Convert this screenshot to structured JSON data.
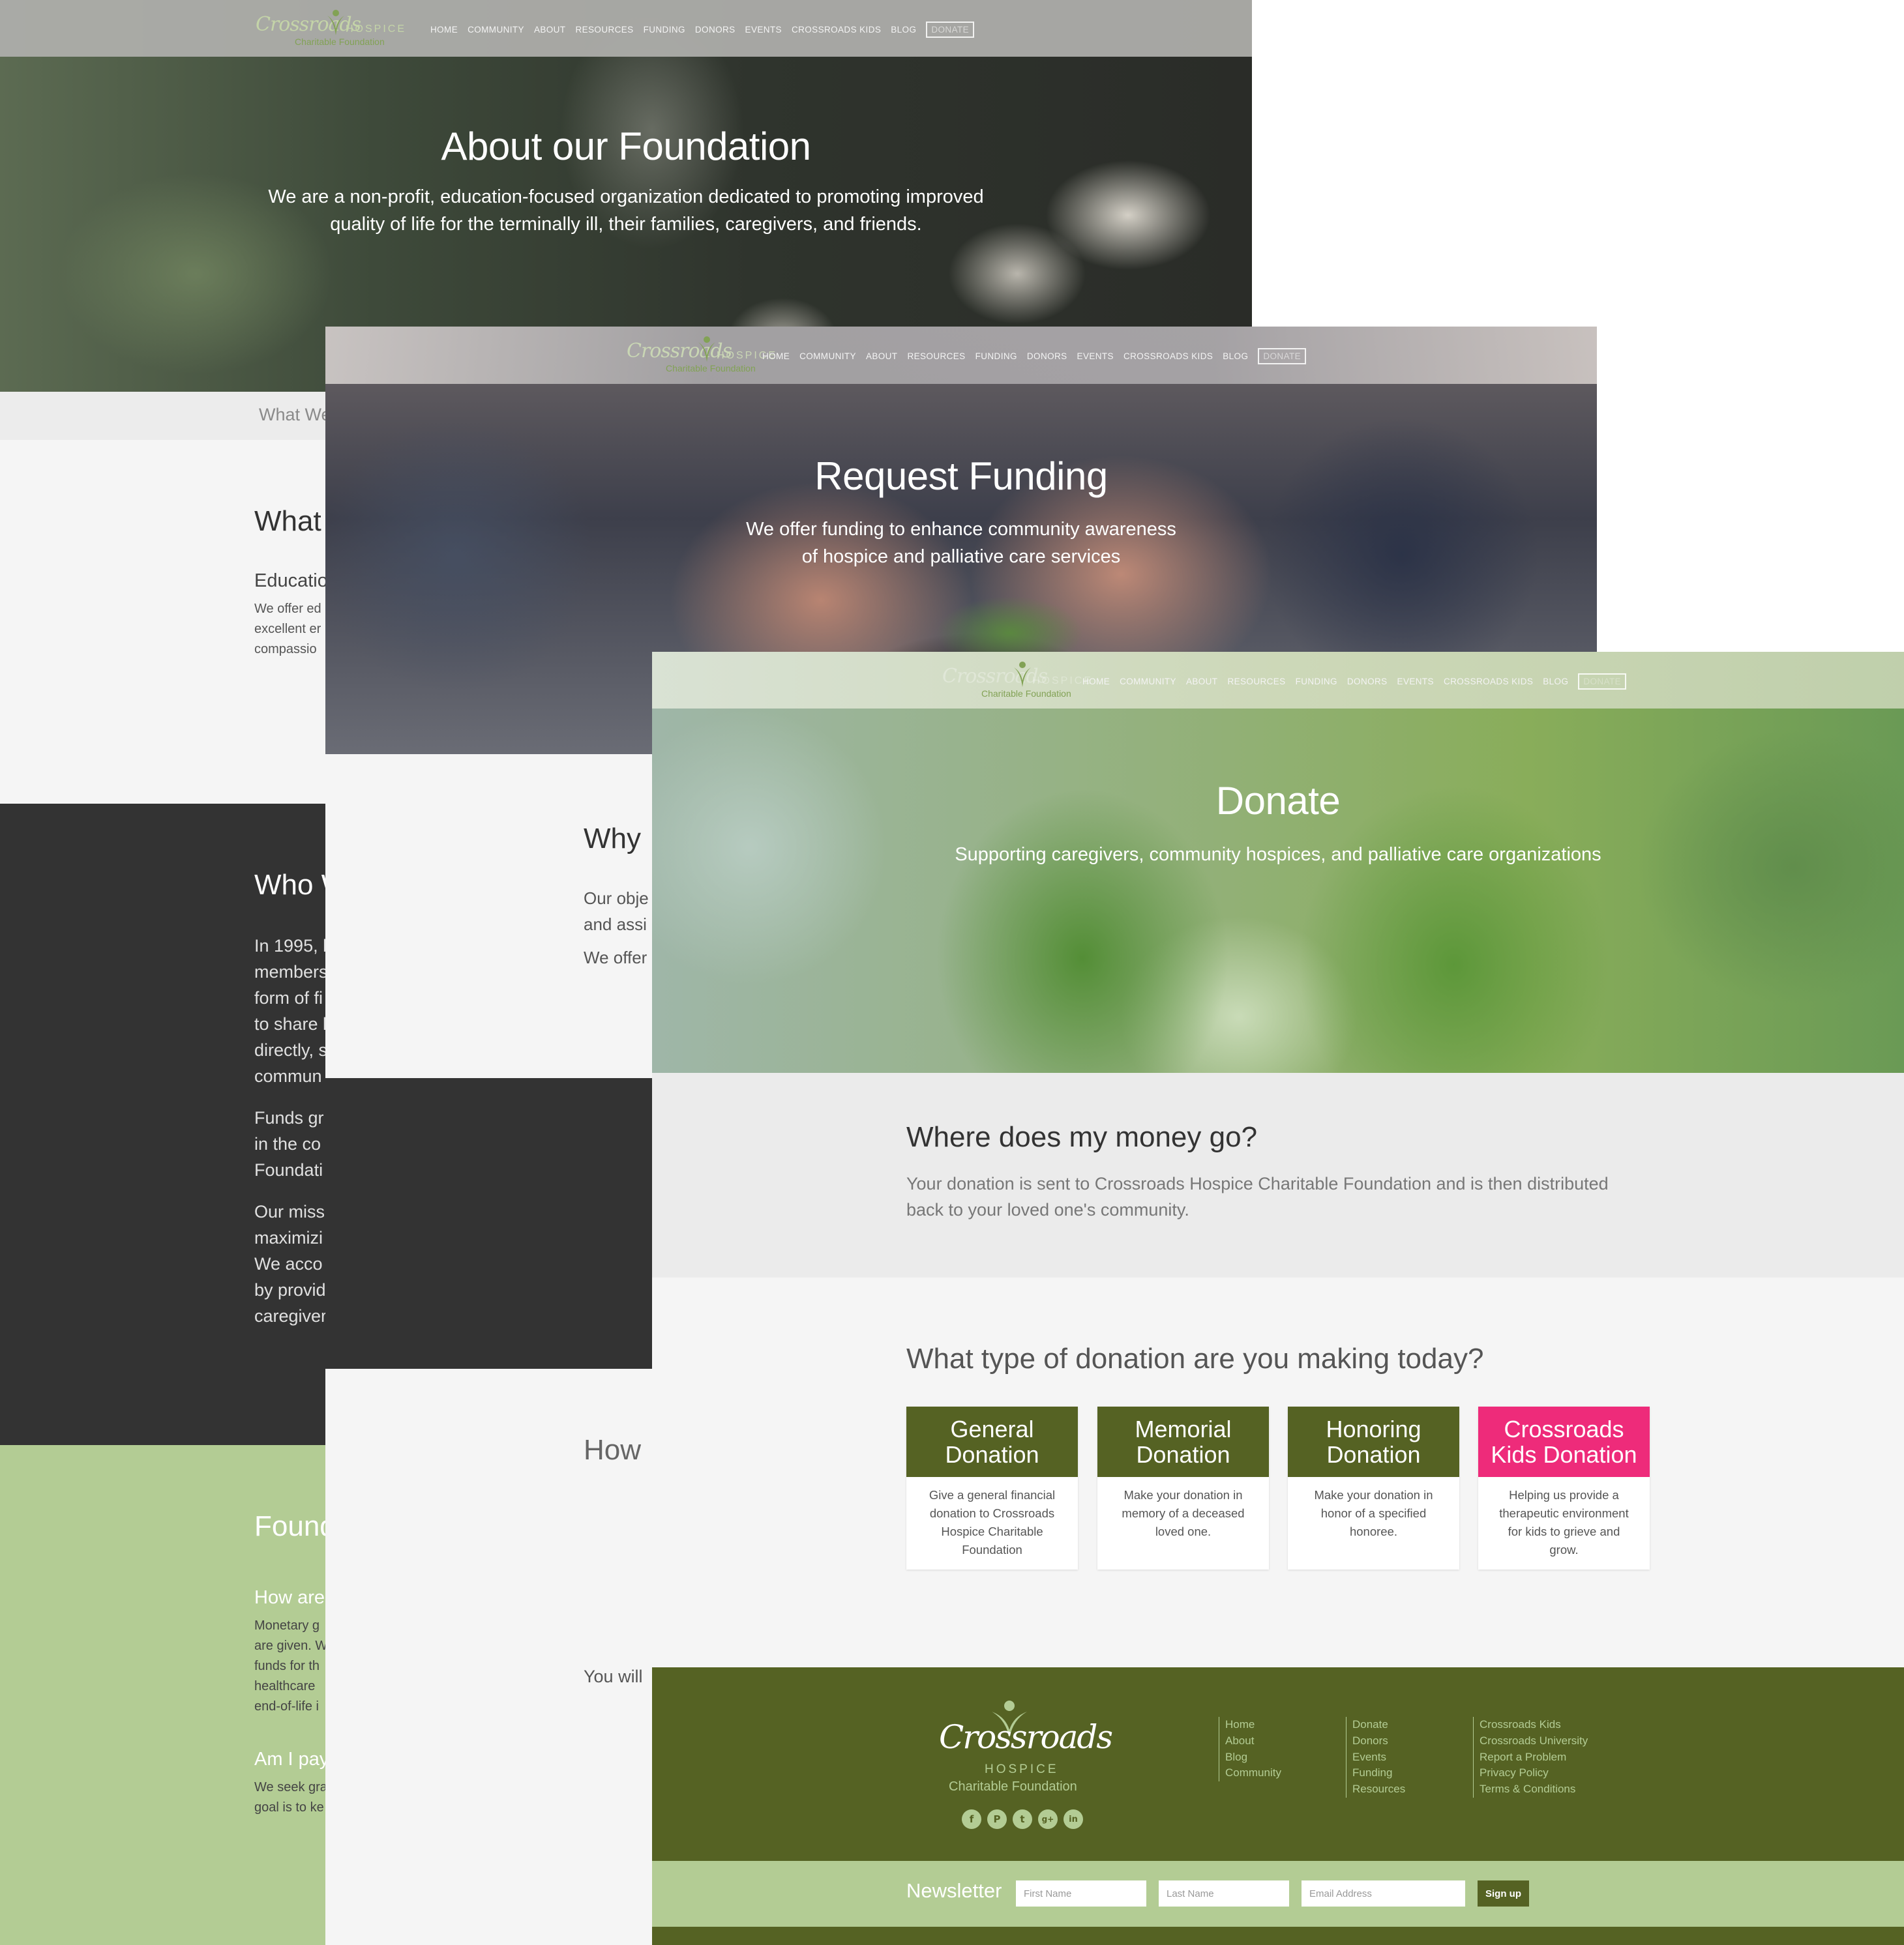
{
  "colors": {
    "olive": "#556223",
    "sage": "#b3cc94",
    "dark": "#333333",
    "pink": "#ee2b7a",
    "light": "#f5f5f5",
    "gray_band": "#ebebeb"
  },
  "nav": {
    "logo_script": "Crossroads",
    "logo_hospice": "HOSPICE",
    "logo_foundation": "Charitable Foundation",
    "items": [
      "HOME",
      "COMMUNITY",
      "ABOUT",
      "RESOURCES",
      "FUNDING",
      "DONORS",
      "EVENTS",
      "CROSSROADS KIDS",
      "BLOG"
    ],
    "donate_label": "DONATE"
  },
  "about_page": {
    "hero_title": "About our Foundation",
    "hero_subtitle_line1": "We are a non-profit, education-focused organization dedicated to promoting improved",
    "hero_subtitle_line2": "quality of life for the terminally ill, their families, caregivers, and friends.",
    "tab_label": "What We",
    "what_heading": "What",
    "education_heading": "Educatio",
    "education_lines": [
      "We offer ed",
      "excellent er",
      "compassio"
    ],
    "who_heading": "Who W",
    "who_para1": [
      "In 1995, l",
      "members",
      "form of fi",
      "to share l",
      "directly, s",
      "commun"
    ],
    "who_para2": [
      "Funds gr",
      "in the co",
      "Foundati"
    ],
    "who_para3": [
      "Our miss",
      "maximizi",
      "We acco",
      "by provid",
      "caregiver"
    ],
    "faq_heading": "Found",
    "faq_q1": "How are",
    "faq_a1": [
      "Monetary g",
      "are given. W",
      "funds for th",
      "healthcare",
      "end-of-life i"
    ],
    "faq_q2": "Am I pay",
    "faq_a2": [
      "We seek gra",
      "goal is to ke"
    ]
  },
  "funding_page": {
    "hero_title": "Request Funding",
    "hero_subtitle_line1": "We offer funding to enhance community awareness",
    "hero_subtitle_line2": "of hospice and palliative care services",
    "why_heading": "Why",
    "why_lines": [
      "Our obje",
      "and assi"
    ],
    "why_line3": "We offer",
    "how_heading": "How",
    "you_will": "You will"
  },
  "donate_page": {
    "hero_title": "Donate",
    "hero_subtitle": "Supporting caregivers, community hospices, and palliative care organizations",
    "money_heading": "Where does my money go?",
    "money_body_line1": "Your donation is sent to Crossroads Hospice Charitable Foundation and is then distributed",
    "money_body_line2": "back to your loved one's community.",
    "type_heading": "What type of donation are you making today?",
    "cards": [
      {
        "title": "General Donation",
        "desc": "Give a general financial donation to Crossroads Hospice Charitable Foundation",
        "color": "#556223"
      },
      {
        "title": "Memorial Donation",
        "desc": "Make your donation in memory of a deceased loved one.",
        "color": "#556223"
      },
      {
        "title": "Honoring Donation",
        "desc": "Make your donation in honor of a specified honoree.",
        "color": "#556223"
      },
      {
        "title": "Crossroads Kids Donation",
        "desc": "Helping us provide a therapeutic environment for kids to grieve and grow.",
        "color": "#ee2b7a"
      }
    ]
  },
  "footer": {
    "logo_script": "Crossroads",
    "logo_hospice": "HOSPICE",
    "logo_foundation": "Charitable Foundation",
    "social": [
      {
        "name": "facebook-icon",
        "glyph": "f"
      },
      {
        "name": "pinterest-icon",
        "glyph": "P"
      },
      {
        "name": "twitter-icon",
        "glyph": "t"
      },
      {
        "name": "google-plus-icon",
        "glyph": "g+"
      },
      {
        "name": "linkedin-icon",
        "glyph": "in"
      }
    ],
    "col1": [
      "Home",
      "About",
      "Blog",
      "Community"
    ],
    "col2": [
      "Donate",
      "Donors",
      "Events",
      "Funding",
      "Resources"
    ],
    "col3": [
      "Crossroads Kids",
      "Crossroads University",
      "Report a Problem",
      "Privacy Policy",
      "Terms & Conditions"
    ]
  },
  "newsletter": {
    "label": "Newsletter",
    "first_placeholder": "First Name",
    "last_placeholder": "Last Name",
    "email_placeholder": "Email Address",
    "signup_label": "Sign up"
  }
}
